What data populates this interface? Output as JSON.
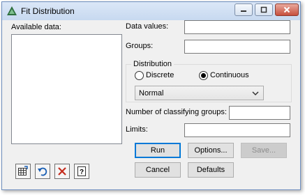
{
  "window": {
    "title": "Fit Distribution",
    "caption_buttons": {
      "minimize": "minimize-icon",
      "maximize": "maximize-icon",
      "close": "close-icon"
    }
  },
  "available_data": {
    "label": "Available data:",
    "items": []
  },
  "fields": {
    "data_values": {
      "label": "Data values:",
      "value": ""
    },
    "groups": {
      "label": "Groups:",
      "value": ""
    },
    "number_of_classifying_groups": {
      "label": "Number of classifying groups:",
      "value": ""
    },
    "limits": {
      "label": "Limits:",
      "value": ""
    }
  },
  "distribution": {
    "legend": "Distribution",
    "options": [
      {
        "label": "Discrete",
        "selected": false
      },
      {
        "label": "Continuous",
        "selected": true
      }
    ],
    "selected_value": "Normal"
  },
  "buttons": {
    "run": "Run",
    "options": "Options...",
    "save": "Save...",
    "cancel": "Cancel",
    "defaults": "Defaults"
  },
  "toolbar_icons": [
    "spreadsheet-icon",
    "undo-icon",
    "clear-icon",
    "help-icon"
  ],
  "colors": {
    "accent": "#0078d7",
    "title_bar": "#c7d9f0",
    "close_button": "#c7503e"
  }
}
